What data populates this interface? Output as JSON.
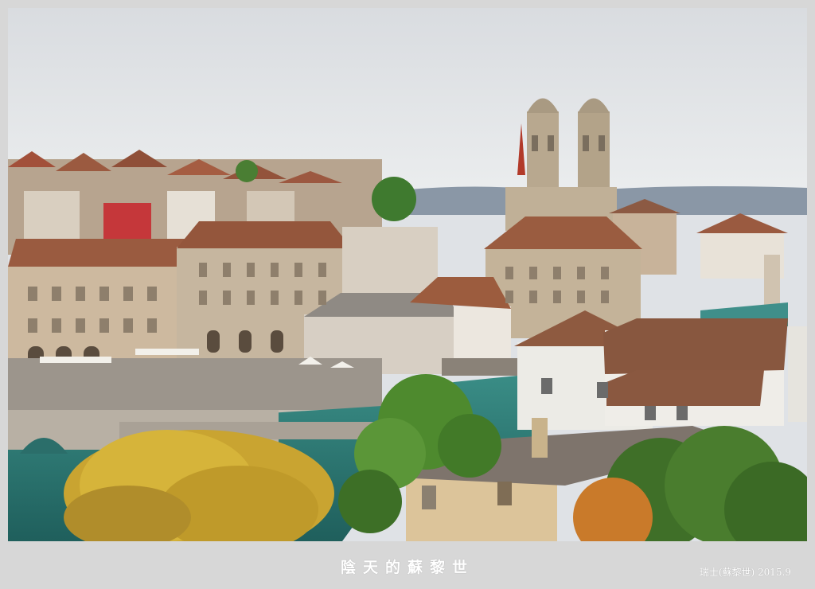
{
  "photo": {
    "scene": "city-panorama-photo"
  },
  "caption": {
    "title": "陰天的蘇黎世",
    "credit": "瑞士(蘇黎世) 2015.9"
  },
  "palette": {
    "border": "#d7d7d7",
    "sky": "#e4e6e9",
    "water": "#2f7f7a",
    "roof": "#9a5a3e",
    "stone": "#c9b9a3",
    "foliage": "#4e8a2e",
    "willow": "#d6b43a",
    "caption_text": "#ffffff"
  }
}
